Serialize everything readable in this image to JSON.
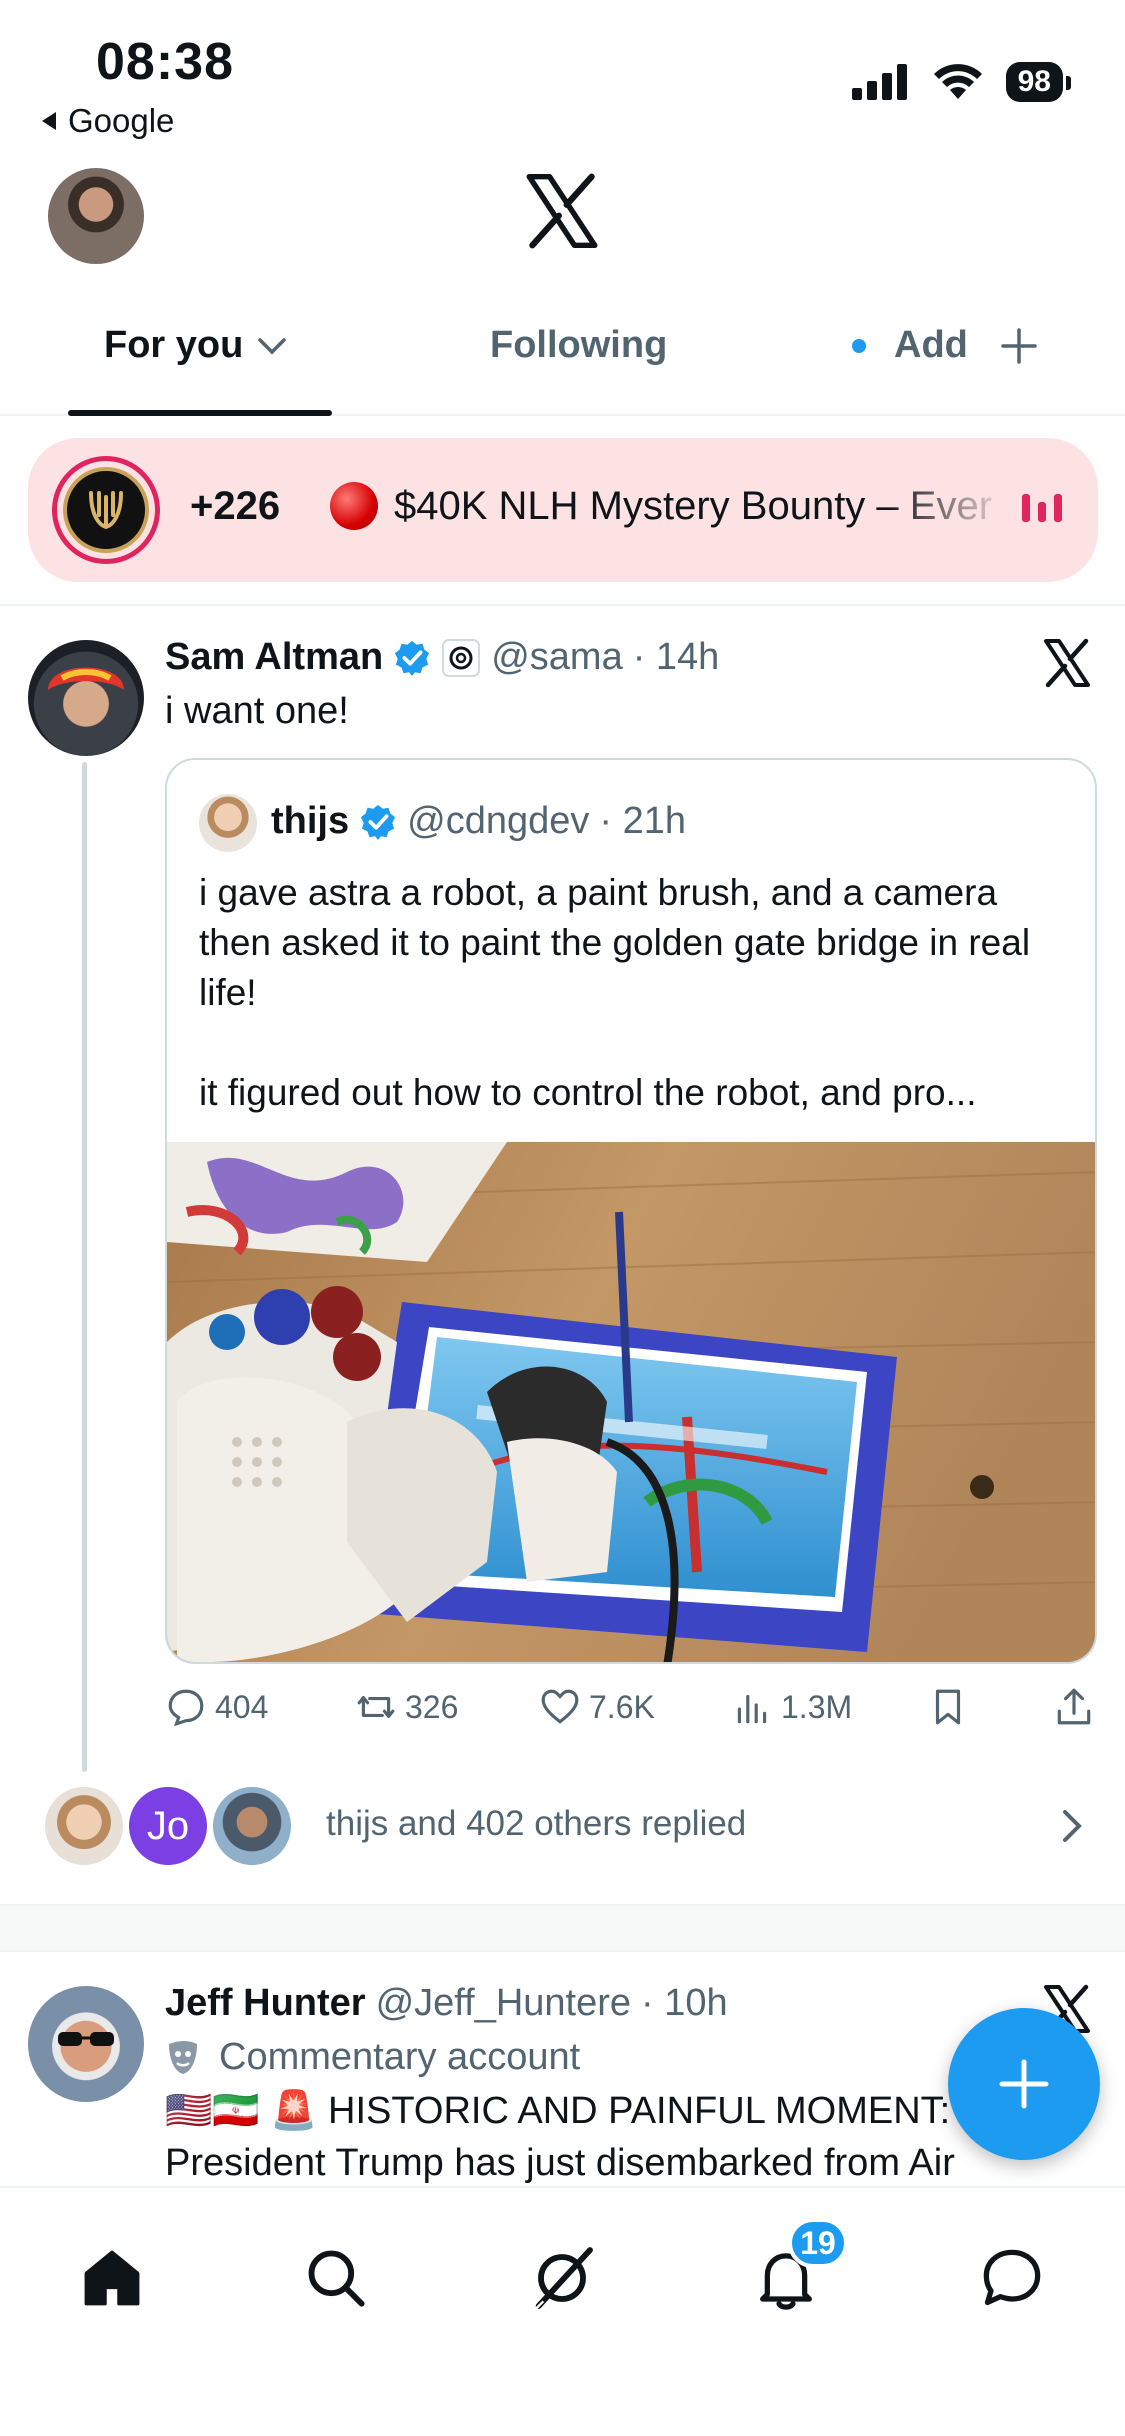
{
  "status_bar": {
    "time": "08:38",
    "back_app": "Google",
    "battery": "98"
  },
  "tabs": {
    "for_you": "For you",
    "following": "Following",
    "add": "Add"
  },
  "live_banner": {
    "count": "+226",
    "title": "$40K NLH Mystery Bounty – Ever"
  },
  "tweet1": {
    "name": "Sam Altman",
    "handle": "@sama",
    "time": "· 14h",
    "text": "i want one!",
    "quote": {
      "name": "thijs",
      "handle": "@cdngdev",
      "time": "· 21h",
      "text": "i gave astra a robot, a paint brush, and a camera then asked it to paint the golden gate bridge in real life!\n\nit figured out how to control the robot, and pro..."
    },
    "actions": {
      "replies": "404",
      "reposts": "326",
      "likes": "7.6K",
      "views": "1.3M"
    },
    "replied_avatar_initials": "Jo",
    "replied_text": "thijs and 402 others replied"
  },
  "tweet2": {
    "name": "Jeff Hunter",
    "handle": "@Jeff_Huntere",
    "time": "· 10h",
    "label": "Commentary account",
    "text": "🇺🇸🇮🇷 🚨 HISTORIC AND PAINFUL MOMENT: President Trump has just disembarked from Air"
  },
  "bottom_nav": {
    "notifications_badge": "19",
    "items": [
      "home-icon",
      "search-icon",
      "grok-icon",
      "bell-icon",
      "messages-icon"
    ]
  },
  "colors": {
    "accent": "#1d9bf0",
    "live_bg": "#fde2e4",
    "secondary_text": "#536471"
  }
}
